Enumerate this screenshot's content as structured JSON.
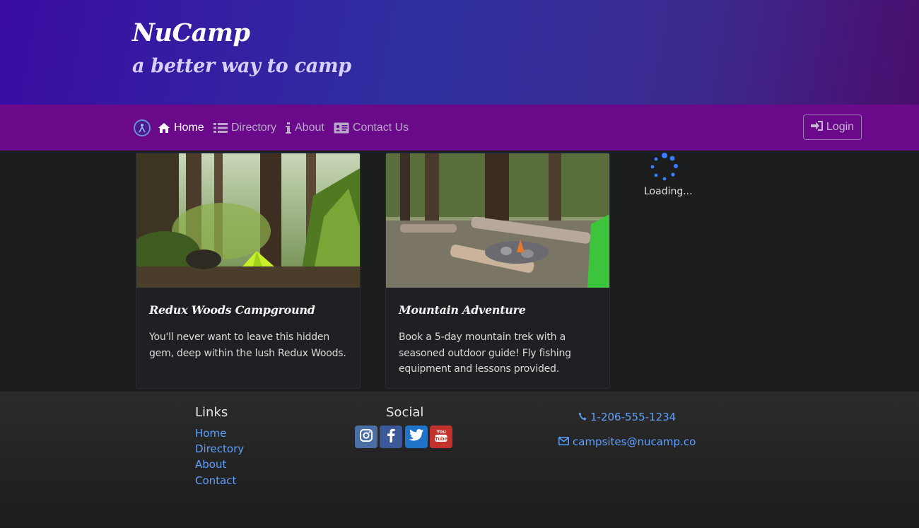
{
  "header": {
    "brand": "NuCamp",
    "tagline": "a better way to camp"
  },
  "navbar": {
    "items": [
      {
        "label": "Home",
        "icon": "home-icon",
        "active": true
      },
      {
        "label": "Directory",
        "icon": "list-icon",
        "active": false
      },
      {
        "label": "About",
        "icon": "info-icon",
        "active": false
      },
      {
        "label": "Contact Us",
        "icon": "address-card-icon",
        "active": false
      }
    ],
    "login_label": "Login"
  },
  "cards": [
    {
      "title": "Redux Woods Campground",
      "text": "You'll never want to leave this hidden gem, deep within the lush Redux Woods.",
      "image": "forest-campsite-tent"
    },
    {
      "title": "Mountain Adventure",
      "text": "Book a 5-day mountain trek with a seasoned outdoor guide! Fly fishing equipment and lessons provided.",
      "image": "campfire-logs"
    }
  ],
  "loading": {
    "text": "Loading..."
  },
  "footer": {
    "links_heading": "Links",
    "links": [
      "Home",
      "Directory",
      "About",
      "Contact"
    ],
    "social_heading": "Social",
    "social": [
      {
        "icon": "instagram-icon",
        "color": "#4a6fa5"
      },
      {
        "icon": "facebook-icon",
        "color": "#3b5998"
      },
      {
        "icon": "twitter-icon",
        "color": "#1f73c9"
      },
      {
        "icon": "youtube-icon",
        "color": "#c4302b"
      }
    ],
    "phone": "1-206-555-1234",
    "email": "campsites@nucamp.co"
  },
  "colors": {
    "header_gradient_start": "#3a0ca3",
    "navbar": "#6a0a8a",
    "body_bg": "#1c1d1f",
    "link": "#5fa0ff"
  }
}
